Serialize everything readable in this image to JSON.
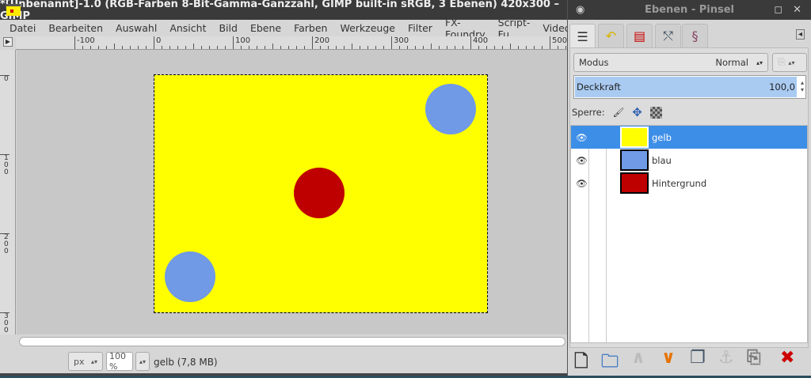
{
  "window": {
    "title": "*[Unbenannt]-1.0 (RGB-Farben 8-Bit-Gamma-Ganzzahl, GIMP built-in sRGB, 3 Ebenen) 420x300 – GIMP"
  },
  "menu": [
    "Datei",
    "Bearbeiten",
    "Auswahl",
    "Ansicht",
    "Bild",
    "Ebene",
    "Farben",
    "Werkzeuge",
    "Filter",
    "FX-Foundry",
    "Script-Fu",
    "Video"
  ],
  "ruler": {
    "h_labels": [
      "-100",
      "0",
      "100",
      "200",
      "300",
      "400",
      "500"
    ],
    "v_labels": [
      "0",
      "100",
      "200",
      "300"
    ]
  },
  "image": {
    "background": "#ffff00",
    "circles": [
      {
        "color": "#7099e6",
        "label": "blue-top-right"
      },
      {
        "color": "#bf0000",
        "label": "red-center"
      },
      {
        "color": "#7099e6",
        "label": "blue-bottom-left"
      }
    ]
  },
  "status": {
    "unit": "px",
    "zoom": "100 %",
    "info": "gelb (7,8 MB)"
  },
  "dock": {
    "title": "Ebenen - Pinsel",
    "mode_label": "Modus",
    "mode_value": "Normal",
    "opacity_label": "Deckkraft",
    "opacity_value": "100,0",
    "lock_label": "Sperre:",
    "layers": [
      {
        "name": "gelb",
        "color": "#ffff00",
        "selected": true
      },
      {
        "name": "blau",
        "color": "#7099e6",
        "selected": false
      },
      {
        "name": "Hintergrund",
        "color": "#bf0000",
        "selected": false
      }
    ]
  }
}
